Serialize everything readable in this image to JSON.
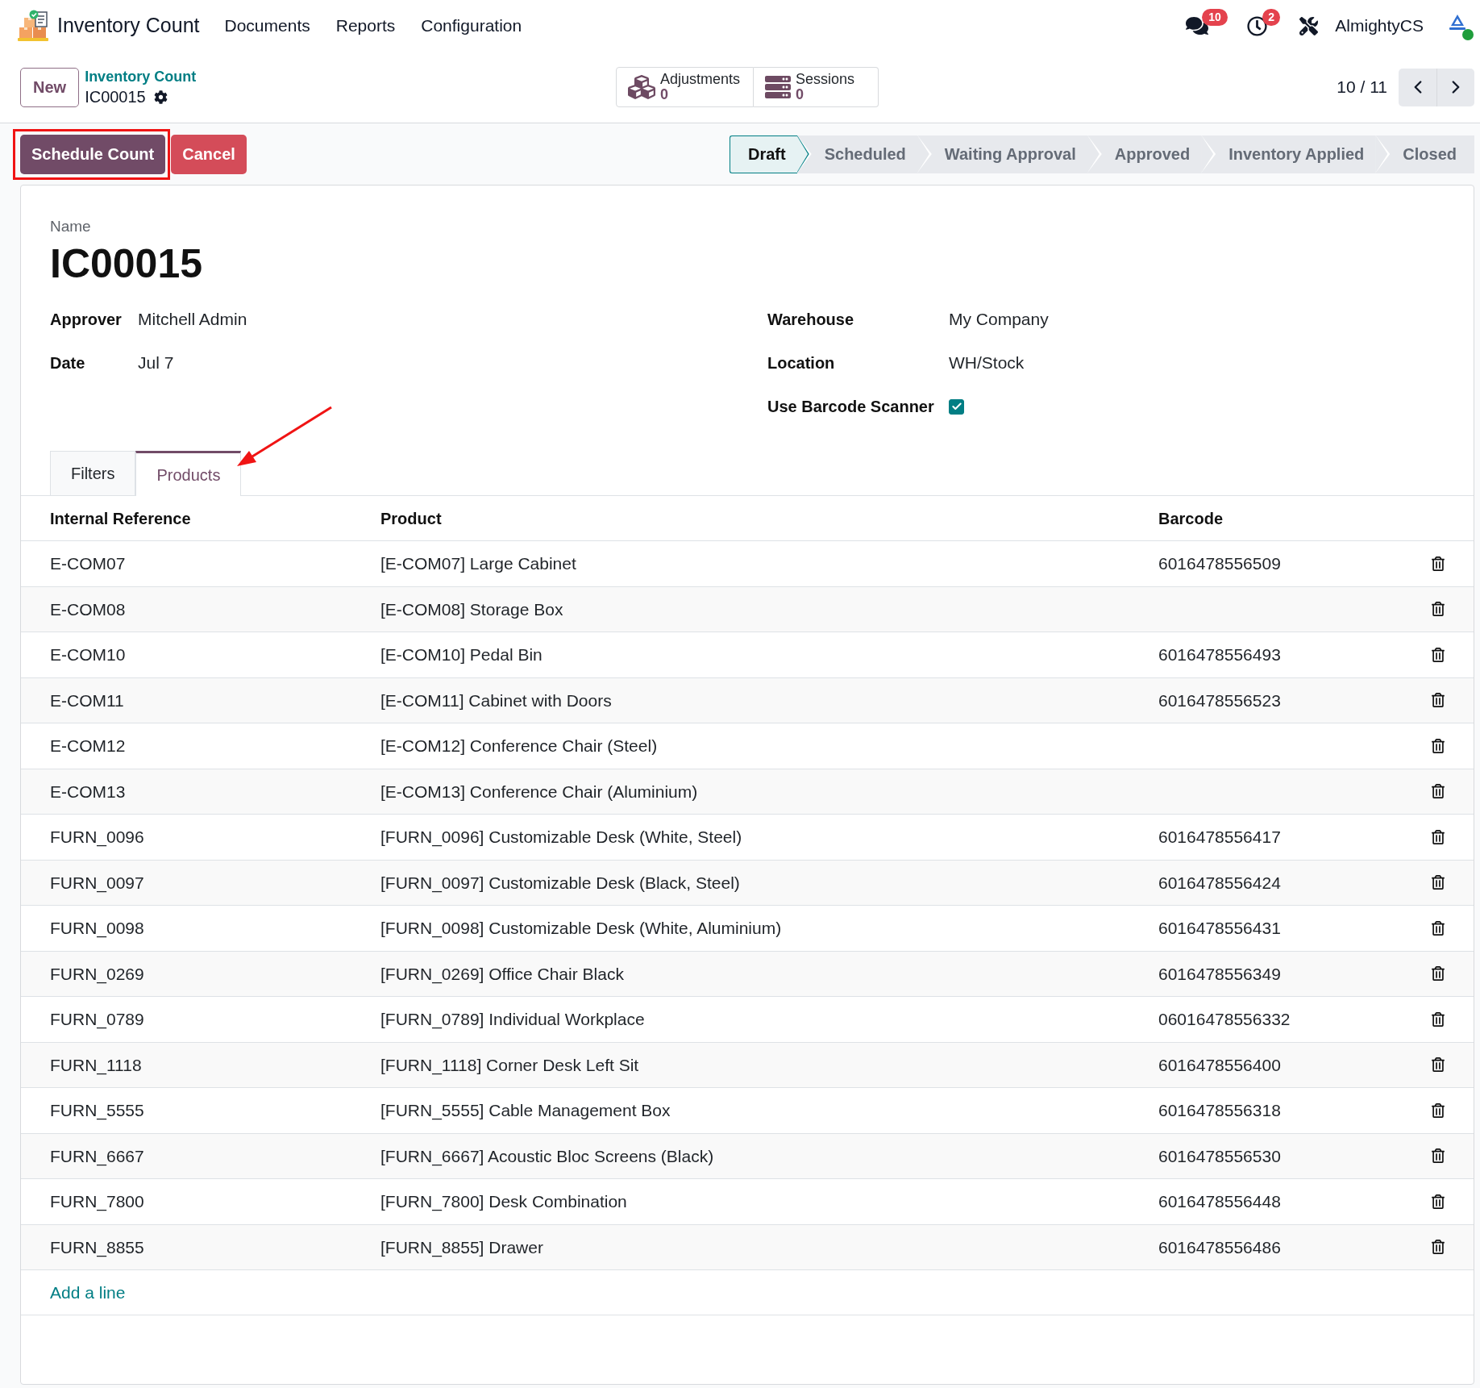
{
  "navbar": {
    "app_name": "Inventory Count",
    "menu": [
      "Documents",
      "Reports",
      "Configuration"
    ],
    "messages_badge": "10",
    "activities_badge": "2",
    "user": {
      "name": "AlmightyCS",
      "online": true
    }
  },
  "control_panel": {
    "new_button": "New",
    "breadcrumb": {
      "parent": "Inventory Count",
      "current": "IC00015"
    },
    "smart_buttons": [
      {
        "kind": "adjustments",
        "label": "Adjustments",
        "value": "0"
      },
      {
        "kind": "sessions",
        "label": "Sessions",
        "value": "0"
      }
    ],
    "pager": "10 / 11"
  },
  "action_buttons": [
    {
      "kind": "primary",
      "label": "Schedule Count",
      "highlighted": true
    },
    {
      "kind": "danger",
      "label": "Cancel",
      "highlighted": false
    }
  ],
  "status_steps": [
    {
      "label": "Draft",
      "selected": true
    },
    {
      "label": "Scheduled",
      "selected": false
    },
    {
      "label": "Waiting Approval",
      "selected": false
    },
    {
      "label": "Approved",
      "selected": false
    },
    {
      "label": "Inventory Applied",
      "selected": false
    },
    {
      "label": "Closed",
      "selected": false
    }
  ],
  "form": {
    "name_label": "Name",
    "name": "IC00015",
    "left_fields": [
      {
        "label": "Approver",
        "value": "Mitchell Admin"
      },
      {
        "label": "Date",
        "value": "Jul 7"
      }
    ],
    "right_fields": [
      {
        "kind": "text",
        "label": "Warehouse",
        "value": "My Company"
      },
      {
        "kind": "text",
        "label": "Location",
        "value": "WH/Stock"
      },
      {
        "kind": "checkbox",
        "label": "Use Barcode Scanner",
        "checked": true
      }
    ]
  },
  "tabs": [
    {
      "label": "Filters",
      "selected": false,
      "annotation_arrow": false
    },
    {
      "label": "Products",
      "selected": true,
      "annotation_arrow": true
    }
  ],
  "table": {
    "columns": [
      "Internal Reference",
      "Product",
      "Barcode"
    ],
    "rows": [
      {
        "internal_reference": "E-COM07",
        "product": "[E-COM07] Large Cabinet",
        "barcode": "6016478556509"
      },
      {
        "internal_reference": "E-COM08",
        "product": "[E-COM08] Storage Box"
      },
      {
        "internal_reference": "E-COM10",
        "product": "[E-COM10] Pedal Bin",
        "barcode": "6016478556493"
      },
      {
        "internal_reference": "E-COM11",
        "product": "[E-COM11] Cabinet with Doors",
        "barcode": "6016478556523"
      },
      {
        "internal_reference": "E-COM12",
        "product": "[E-COM12] Conference Chair (Steel)"
      },
      {
        "internal_reference": "E-COM13",
        "product": "[E-COM13] Conference Chair (Aluminium)"
      },
      {
        "internal_reference": "FURN_0096",
        "product": "[FURN_0096] Customizable Desk (White, Steel)",
        "barcode": "6016478556417"
      },
      {
        "internal_reference": "FURN_0097",
        "product": "[FURN_0097] Customizable Desk (Black, Steel)",
        "barcode": "6016478556424"
      },
      {
        "internal_reference": "FURN_0098",
        "product": "[FURN_0098] Customizable Desk (White, Aluminium)",
        "barcode": "6016478556431"
      },
      {
        "internal_reference": "FURN_0269",
        "product": "[FURN_0269] Office Chair Black",
        "barcode": "6016478556349"
      },
      {
        "internal_reference": "FURN_0789",
        "product": "[FURN_0789] Individual Workplace",
        "barcode": "06016478556332"
      },
      {
        "internal_reference": "FURN_1118",
        "product": "[FURN_1118] Corner Desk Left Sit",
        "barcode": "6016478556400"
      },
      {
        "internal_reference": "FURN_5555",
        "product": "[FURN_5555] Cable Management Box",
        "barcode": "6016478556318"
      },
      {
        "internal_reference": "FURN_6667",
        "product": "[FURN_6667] Acoustic Bloc Screens (Black)",
        "barcode": "6016478556530"
      },
      {
        "internal_reference": "FURN_7800",
        "product": "[FURN_7800] Desk Combination",
        "barcode": "6016478556448"
      },
      {
        "internal_reference": "FURN_8855",
        "product": "[FURN_8855] Drawer",
        "barcode": "6016478556486"
      }
    ],
    "add_line": "Add a line"
  }
}
